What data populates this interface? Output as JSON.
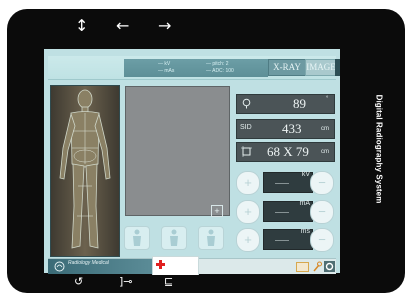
{
  "app": {
    "title": "Digital Radiography System"
  },
  "top_nav": {
    "resize_glyph": "↕",
    "back_glyph": "←",
    "forward_glyph": "→"
  },
  "header": {
    "stripe_left": [
      "— kV",
      "— mAs"
    ],
    "stripe_right": [
      "— pitch: 2",
      "— ADC: 100"
    ],
    "tabs": [
      {
        "label": "X-RAY",
        "active": true
      },
      {
        "label": "IMAGE",
        "active": false
      }
    ]
  },
  "readouts": {
    "angle": {
      "icon": "angle-icon",
      "value": "89",
      "unit": "°"
    },
    "sid": {
      "label": "SID",
      "value": "433",
      "unit": "cm"
    },
    "field": {
      "icon": "field-size-icon",
      "value": "68 X 79",
      "unit": "cm"
    }
  },
  "steppers": [
    {
      "unit": "kV",
      "value": "——",
      "plus": "+",
      "minus": "−"
    },
    {
      "unit": "mA",
      "value": "——",
      "plus": "+",
      "minus": "−"
    },
    {
      "unit": "ms",
      "value": "——",
      "plus": "+",
      "minus": "−"
    }
  ],
  "image_area": {
    "add_symbol": "+"
  },
  "bottom": {
    "brand": "Radiology Medical"
  },
  "bottom_nav": {
    "back_glyph": "↺",
    "recent_glyph": "]⊸",
    "settings_glyph": "⊑"
  },
  "colors": {
    "screen_bg": "#bfe0e3",
    "accent_dark": "#4b5457",
    "cross_red": "#e02020"
  }
}
